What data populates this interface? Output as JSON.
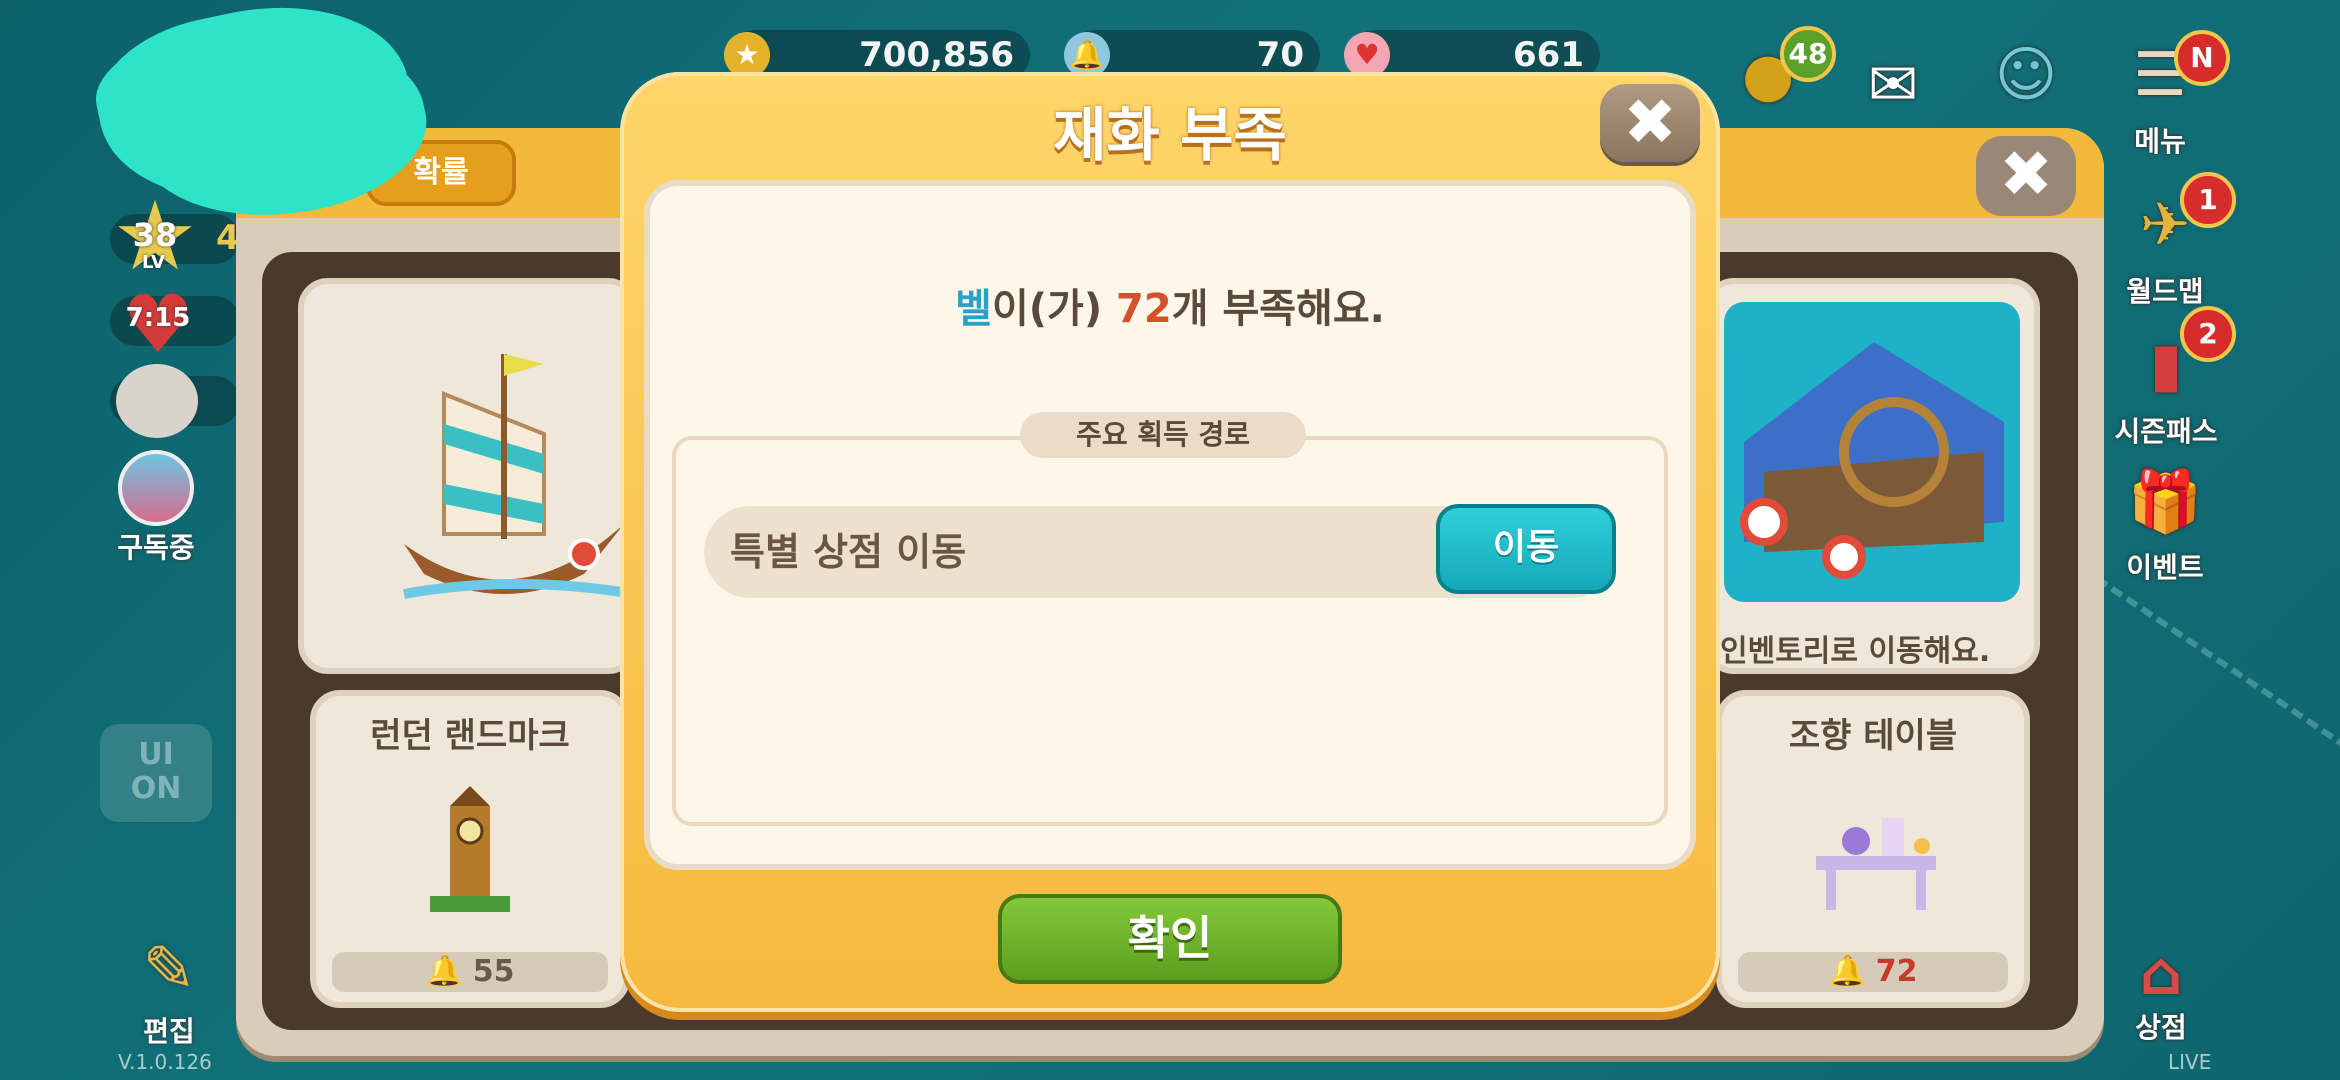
{
  "currencies": [
    {
      "icon": "gold-coin-icon",
      "value": "700,856"
    },
    {
      "icon": "bell-icon",
      "value": "70"
    },
    {
      "icon": "heart-ticket-icon",
      "value": "661"
    }
  ],
  "player": {
    "level": "38",
    "level_suffix": "LV",
    "hearts_timer": "7:15",
    "partial_value": "4"
  },
  "left_menu": {
    "subscribe_label": "구독중",
    "edit_label": "편집",
    "ui_toggle": "UI\nON"
  },
  "right_menu": {
    "egg_badge": "48",
    "menu_badge": "N",
    "menu_label": "메뉴",
    "worldmap_label": "월드맵",
    "worldmap_badge": "1",
    "seasonpass_label": "시즌패스",
    "seasonpass_badge": "2",
    "event_label": "이벤트",
    "shop_label": "상점"
  },
  "shop_panel": {
    "help_label": "?",
    "probability_label": "확률",
    "card_left": {
      "title": "런던 랜드마크",
      "price": "55"
    },
    "card_right": {
      "title": "조향 테이블",
      "price": "72"
    },
    "hint": "인벤토리로 이동해요."
  },
  "dialog": {
    "title": "재화 부족",
    "message_item": "벨",
    "message_mid": "이(가) ",
    "message_number": "72",
    "message_end": "개 부족해요.",
    "route_label": "주요 획득 경로",
    "route_text": "특별 상점 이동",
    "move_button": "이동",
    "confirm_button": "확인"
  },
  "footer": {
    "version": "V.1.0.126",
    "live": "LIVE"
  }
}
